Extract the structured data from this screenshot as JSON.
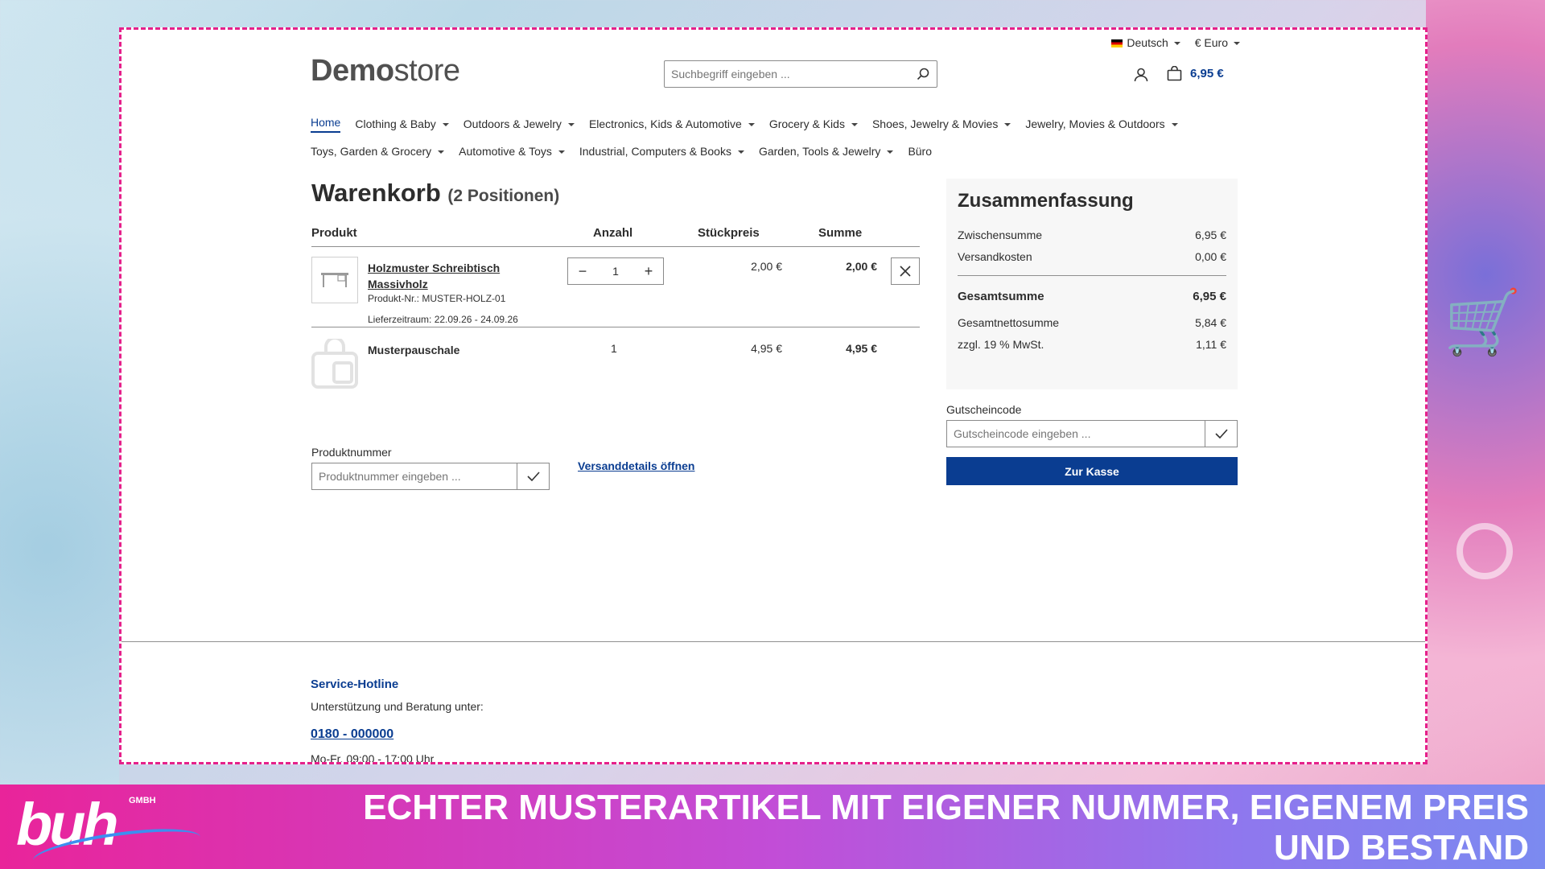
{
  "topbar": {
    "language": "Deutsch",
    "currency": "€ Euro"
  },
  "header": {
    "logo_bold": "Demo",
    "logo_light": "store",
    "search_placeholder": "Suchbegriff eingeben ...",
    "cart_total": "6,95 €"
  },
  "nav": {
    "row1": [
      {
        "label": "Home",
        "dropdown": false,
        "active": true
      },
      {
        "label": "Clothing & Baby",
        "dropdown": true
      },
      {
        "label": "Outdoors & Jewelry",
        "dropdown": true
      },
      {
        "label": "Electronics, Kids & Automotive",
        "dropdown": true
      },
      {
        "label": "Grocery & Kids",
        "dropdown": true
      },
      {
        "label": "Shoes, Jewelry & Movies",
        "dropdown": true
      },
      {
        "label": "Jewelry, Movies & Outdoors",
        "dropdown": true
      }
    ],
    "row2": [
      {
        "label": "Toys, Garden & Grocery",
        "dropdown": true
      },
      {
        "label": "Automotive & Toys",
        "dropdown": true
      },
      {
        "label": "Industrial, Computers & Books",
        "dropdown": true
      },
      {
        "label": "Garden, Tools & Jewelry",
        "dropdown": true
      },
      {
        "label": "Büro",
        "dropdown": false
      }
    ]
  },
  "cart": {
    "title": "Warenkorb",
    "count": "(2 Positionen)",
    "columns": {
      "product": "Produkt",
      "qty": "Anzahl",
      "unit": "Stückpreis",
      "sum": "Summe"
    },
    "items": [
      {
        "name": "Holzmuster Schreibtisch Massivholz",
        "number": "Produkt-Nr.: MUSTER-HOLZ-01",
        "delivery": "Lieferzeitraum: 22.09.26 - 24.09.26",
        "qty": "1",
        "unit": "2,00 €",
        "sum": "2,00 €"
      },
      {
        "name": "Musterpauschale",
        "qty": "1",
        "unit": "4,95 €",
        "sum": "4,95 €"
      }
    ],
    "product_number_label": "Produktnummer",
    "product_number_placeholder": "Produktnummer eingeben ...",
    "shipping_link": "Versanddetails öffnen"
  },
  "summary": {
    "title": "Zusammenfassung",
    "subtotal_label": "Zwischensumme",
    "subtotal": "6,95 €",
    "shipping_label": "Versandkosten",
    "shipping": "0,00 €",
    "total_label": "Gesamtsumme",
    "total": "6,95 €",
    "net_label": "Gesamtnettosumme",
    "net": "5,84 €",
    "vat_label": "zzgl. 19 % MwSt.",
    "vat": "1,11 €",
    "voucher_label": "Gutscheincode",
    "voucher_placeholder": "Gutscheincode eingeben ...",
    "checkout": "Zur Kasse"
  },
  "footer": {
    "title": "Service-Hotline",
    "subtitle": "Unterstützung und Beratung unter:",
    "phone": "0180 - 000000",
    "hours": "Mo-Fr, 09:00 - 17:00 Uhr"
  },
  "banner": {
    "logo": "buh",
    "logo_suffix": "GMBH",
    "text": "Echter Musterartikel mit eigener Nummer, eigenem Preis und Bestand"
  },
  "colors": {
    "accent": "#0a3d91",
    "frame": "#e5218b"
  }
}
